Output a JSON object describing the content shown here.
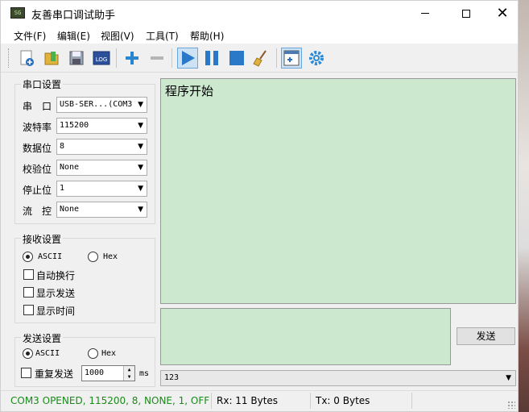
{
  "window": {
    "title": "友善串口调试助手",
    "app_icon_text": "SG"
  },
  "menu": [
    "文件(F)",
    "编辑(E)",
    "视图(V)",
    "工具(T)",
    "帮助(H)"
  ],
  "toolbar": {
    "log_label": "LOG"
  },
  "serial_settings": {
    "title": "串口设置",
    "port_label": "串　口",
    "port_value": "USB-SER...(COM3",
    "baud_label": "波特率",
    "baud_value": "115200",
    "databits_label": "数据位",
    "databits_value": "8",
    "parity_label": "校验位",
    "parity_value": "None",
    "stopbits_label": "停止位",
    "stopbits_value": "1",
    "flow_label": "流　控",
    "flow_value": "None"
  },
  "receive_settings": {
    "title": "接收设置",
    "ascii_label": "ASCII",
    "hex_label": "Hex",
    "auto_newline_label": "自动换行",
    "show_send_label": "显示发送",
    "show_time_label": "显示时间"
  },
  "send_settings": {
    "title": "发送设置",
    "ascii_label": "ASCII",
    "hex_label": "Hex",
    "repeat_label": "重复发送",
    "interval_value": "1000",
    "interval_unit": "ms"
  },
  "receive_area": {
    "text": "程序开始"
  },
  "send_button_label": "发送",
  "history_value": "123",
  "status": {
    "connection": "COM3 OPENED, 115200, 8, NONE, 1, OFF",
    "rx": "Rx: 11 Bytes",
    "tx": "Tx: 0 Bytes",
    "connection_color": "#1a8a1a"
  }
}
